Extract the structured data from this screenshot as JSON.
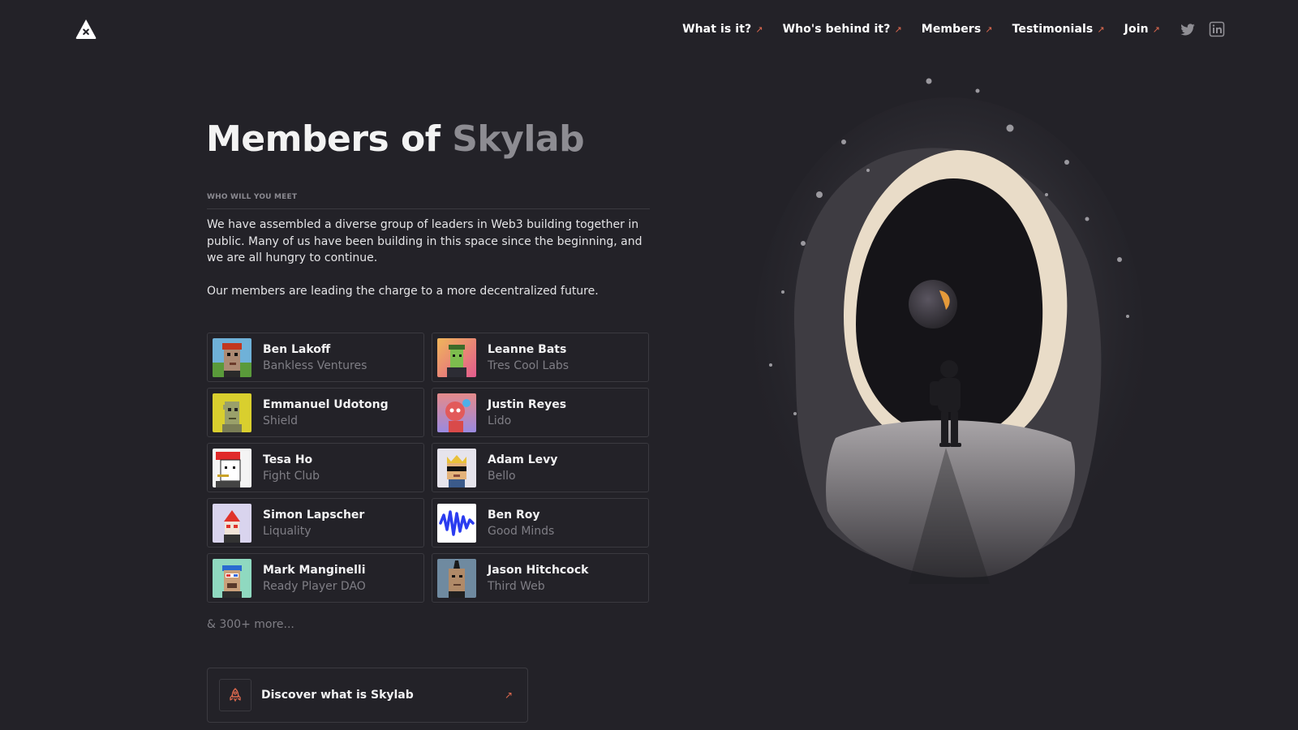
{
  "header": {
    "nav": [
      {
        "label": "What is it?",
        "arrow": "↗"
      },
      {
        "label": "Who's behind it?",
        "arrow": "↗"
      },
      {
        "label": "Members",
        "arrow": "↗"
      },
      {
        "label": "Testimonials",
        "arrow": "↗"
      },
      {
        "label": "Join",
        "arrow": "↗"
      }
    ],
    "social": [
      "twitter-icon",
      "linkedin-icon"
    ]
  },
  "hero": {
    "title_main": "Members of",
    "title_accent": "Skylab",
    "eyebrow": "WHO WILL YOU MEET",
    "paragraphs": [
      "We have assembled a diverse group of leaders in Web3 building together in public. Many of us have been building in this space since the beginning, and we are all hungry to continue.",
      "Our members are leading the charge to a more decentralized future."
    ]
  },
  "members": [
    {
      "name": "Ben Lakoff",
      "org": "Bankless Ventures"
    },
    {
      "name": "Leanne Bats",
      "org": "Tres Cool Labs"
    },
    {
      "name": "Emmanuel Udotong",
      "org": "Shield"
    },
    {
      "name": "Justin Reyes",
      "org": "Lido"
    },
    {
      "name": "Tesa Ho",
      "org": "Fight Club"
    },
    {
      "name": "Adam Levy",
      "org": "Bello"
    },
    {
      "name": "Simon Lapscher",
      "org": "Liquality"
    },
    {
      "name": "Ben Roy",
      "org": "Good Minds"
    },
    {
      "name": "Mark Manginelli",
      "org": "Ready Player DAO"
    },
    {
      "name": "Jason Hitchcock",
      "org": "Third Web"
    }
  ],
  "more_text": "& 300+ more...",
  "cta": {
    "label": "Discover what is Skylab",
    "arrow": "↗"
  },
  "colors": {
    "background": "#232228",
    "accent": "#e06a4f",
    "muted": "#7f7e85"
  }
}
